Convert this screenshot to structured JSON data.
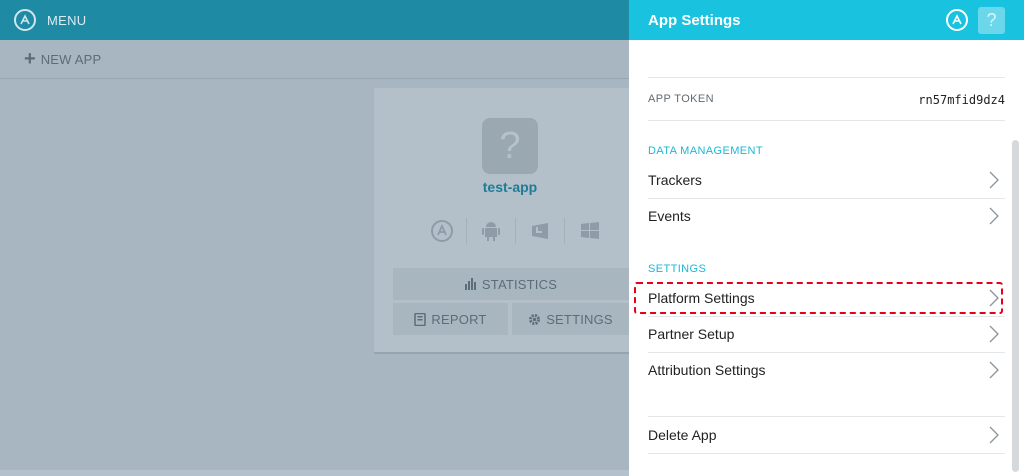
{
  "topbar": {
    "menu_label": "MENU"
  },
  "subbar": {
    "new_app_label": "NEW APP"
  },
  "card": {
    "app_name": "test-app",
    "statistics_label": "STATISTICS",
    "report_label": "REPORT",
    "settings_label": "SETTINGS",
    "platforms": [
      "app-store-icon",
      "android-icon",
      "windows-store-icon",
      "windows-icon"
    ]
  },
  "panel": {
    "title": "App Settings",
    "help_glyph": "?",
    "token_label": "APP TOKEN",
    "token_value": "rn57mfid9dz4",
    "data_management_label": "DATA MANAGEMENT",
    "settings_label": "SETTINGS",
    "rows": {
      "trackers": "Trackers",
      "events": "Events",
      "platform_settings": "Platform Settings",
      "partner_setup": "Partner Setup",
      "attribution_settings": "Attribution Settings",
      "delete_app": "Delete App"
    }
  },
  "colors": {
    "header_cyan": "#19c3e0",
    "topbar_teal": "#1f8aa4",
    "section_cyan": "#1bb8d6",
    "highlight_red": "#e8001a",
    "app_name_teal": "#1e7c96"
  }
}
